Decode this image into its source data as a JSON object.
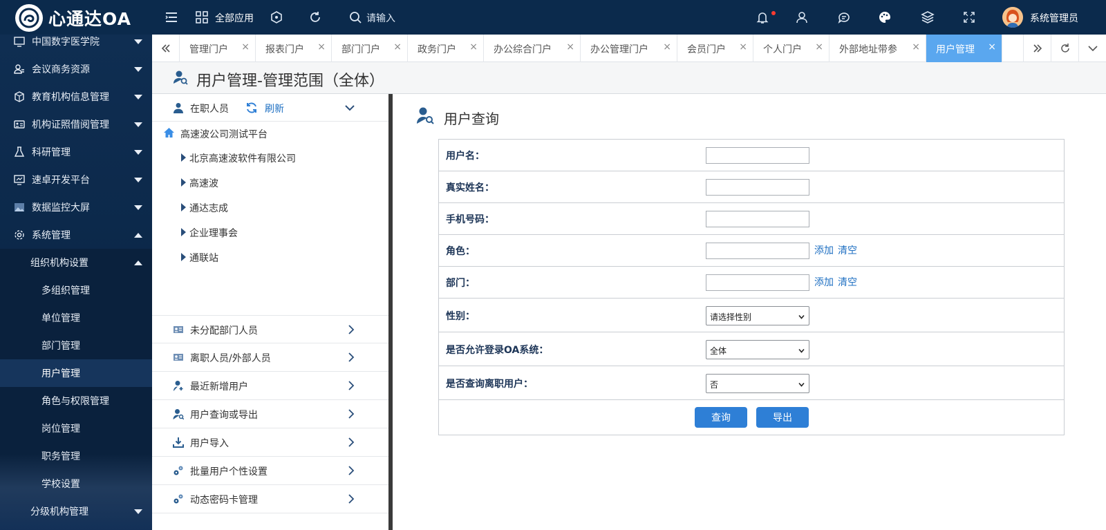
{
  "app": {
    "name": "心通达OA"
  },
  "topbar": {
    "all_apps": "全部应用",
    "search_placeholder": "请输入",
    "user_name": "系统管理员"
  },
  "sidebar": {
    "items": [
      {
        "label": "中国数字医学院",
        "icon": "monitor-icon",
        "caret": "down"
      },
      {
        "label": "会议商务资源",
        "icon": "person-group-icon",
        "caret": "down"
      },
      {
        "label": "教育机构信息管理",
        "icon": "cube-icon",
        "caret": "down"
      },
      {
        "label": "机构证照借阅管理",
        "icon": "id-card-icon",
        "caret": "down"
      },
      {
        "label": "科研管理",
        "icon": "flask-icon",
        "caret": "down"
      },
      {
        "label": "速卓开发平台",
        "icon": "monitor-icon",
        "caret": "down"
      },
      {
        "label": "数据监控大屏",
        "icon": "image-icon",
        "caret": "down"
      },
      {
        "label": "系统管理",
        "icon": "gear-icon",
        "caret": "up"
      }
    ],
    "submenu": {
      "label": "组织机构设置",
      "items": [
        "多组织管理",
        "单位管理",
        "部门管理",
        "用户管理",
        "角色与权限管理",
        "岗位管理",
        "职务管理",
        "学校设置"
      ],
      "active": "用户管理"
    },
    "next_group": "分级机构管理"
  },
  "tabs": {
    "items": [
      "管理门户",
      "报表门户",
      "部门门户",
      "政务门户",
      "办公综合门户",
      "办公管理门户",
      "会员门户",
      "个人门户",
      "外部地址带参",
      "用户管理"
    ],
    "active": "用户管理"
  },
  "page": {
    "title": "用户管理-管理范围（全体）"
  },
  "left_panel": {
    "header": {
      "label": "在职人员",
      "refresh": "刷新"
    },
    "tree": {
      "root": "高速波公司测试平台",
      "nodes": [
        "北京高速波软件有限公司",
        "高速波",
        "通达志成",
        "企业理事会",
        "通联站"
      ]
    },
    "menu": [
      "未分配部门人员",
      "离职人员/外部人员",
      "最近新增用户",
      "用户查询或导出",
      "用户导入",
      "批量用户个性设置",
      "动态密码卡管理"
    ]
  },
  "query": {
    "heading": "用户查询",
    "fields": {
      "username": {
        "label": "用户名：",
        "value": ""
      },
      "realname": {
        "label": "真实姓名：",
        "value": ""
      },
      "mobile": {
        "label": "手机号码：",
        "value": ""
      },
      "role": {
        "label": "角色：",
        "value": "",
        "add": "添加",
        "clear": "清空"
      },
      "dept": {
        "label": "部门：",
        "value": "",
        "add": "添加",
        "clear": "清空"
      },
      "gender": {
        "label": "性别：",
        "selected": "请选择性别"
      },
      "allow_login": {
        "label": "是否允许登录OA系统：",
        "selected": "全体"
      },
      "query_resigned": {
        "label": "是否查询离职用户：",
        "selected": "否"
      }
    },
    "buttons": {
      "query": "查询",
      "export": "导出"
    }
  },
  "colors": {
    "topbar": "#0b2a4c",
    "accent_tab": "#5aa7ef",
    "button": "#2e7fd6",
    "link": "#1e6fc2"
  }
}
